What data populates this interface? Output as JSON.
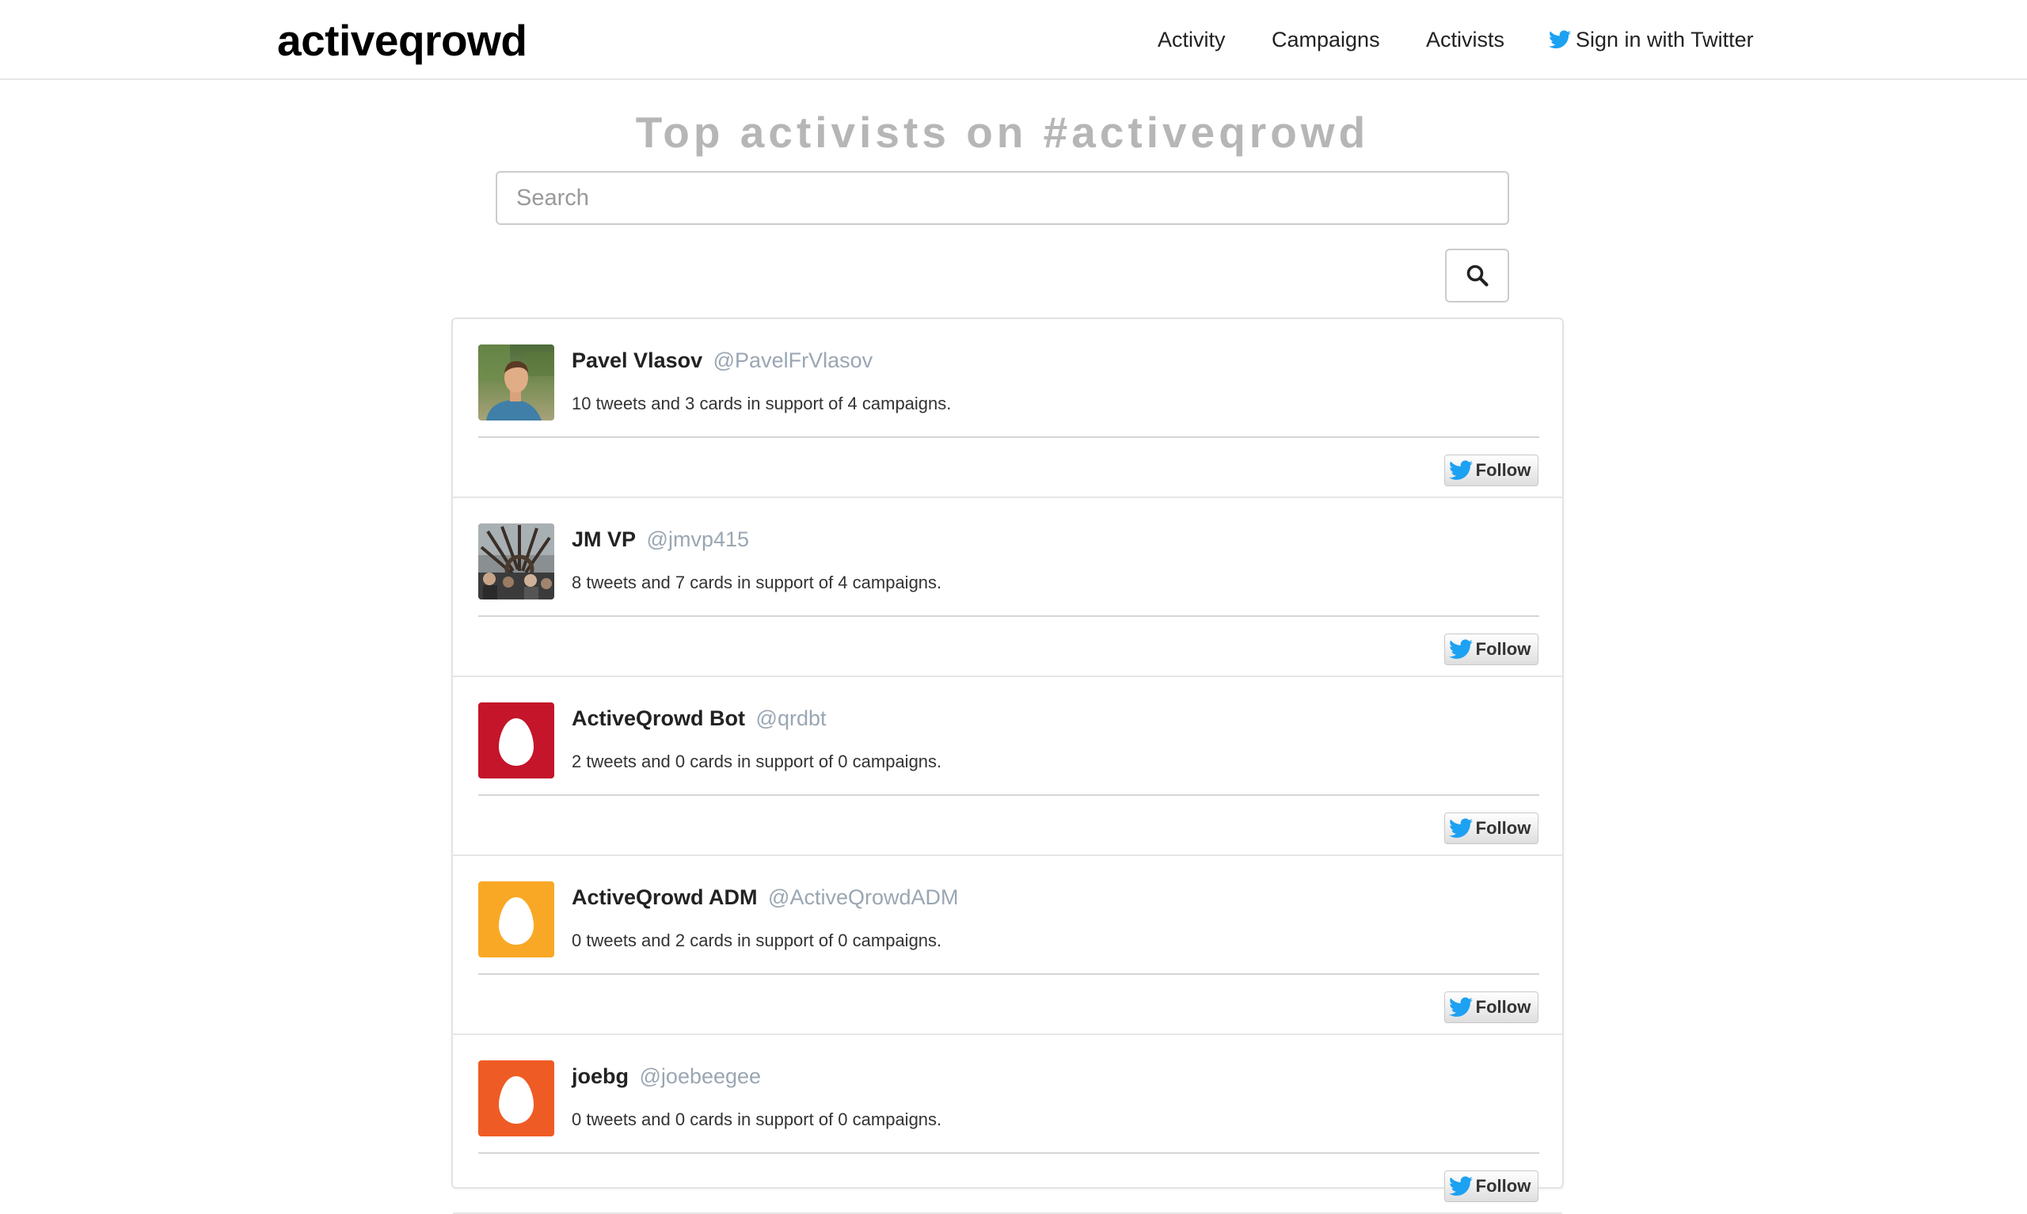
{
  "brand": "activeqrowd",
  "nav": {
    "activity": "Activity",
    "campaigns": "Campaigns",
    "activists": "Activists",
    "signin": "Sign in with Twitter"
  },
  "heading": "Top activists on #activeqrowd",
  "search": {
    "placeholder": "Search",
    "value": ""
  },
  "follow_label": "Follow",
  "colors": {
    "twitter_blue": "#1da1f2",
    "handle_gray": "#9aa6b2",
    "heading_gray": "#b6b6b6"
  },
  "activists": [
    {
      "name": "Pavel Vlasov",
      "handle": "@PavelFrVlasov",
      "stats": "10 tweets and 3 cards in support of 4 campaigns.",
      "avatar": "photo-portrait"
    },
    {
      "name": "JM VP",
      "handle": "@jmvp415",
      "stats": "8 tweets and 7 cards in support of 4 campaigns.",
      "avatar": "photo-crowd"
    },
    {
      "name": "ActiveQrowd Bot",
      "handle": "@qrdbt",
      "stats": "2 tweets and 0 cards in support of 0 campaigns.",
      "avatar": "egg-icon",
      "avatar_color": "#c4152a"
    },
    {
      "name": "ActiveQrowd ADM",
      "handle": "@ActiveQrowdADM",
      "stats": "0 tweets and 2 cards in support of 0 campaigns.",
      "avatar": "egg-icon",
      "avatar_color": "#f9a825"
    },
    {
      "name": "joebg",
      "handle": "@joebeegee",
      "stats": "0 tweets and 0 cards in support of 0 campaigns.",
      "avatar": "egg-icon",
      "avatar_color": "#ef5b24"
    }
  ]
}
